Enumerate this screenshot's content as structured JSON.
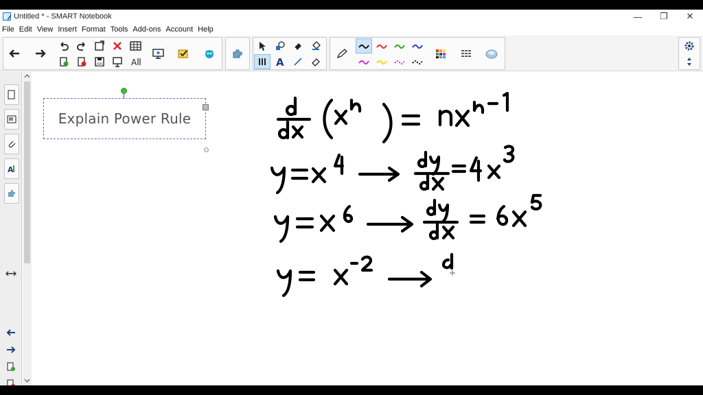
{
  "window": {
    "title": "Untitled * - SMART Notebook",
    "minimize": "—",
    "restore": "❐",
    "close": "✕"
  },
  "menu": [
    "File",
    "Edit",
    "View",
    "Insert",
    "Format",
    "Tools",
    "Add-ons",
    "Account",
    "Help"
  ],
  "canvas": {
    "textbox": "Explain Power Rule"
  },
  "colors": {
    "pen_red": "#e0302a",
    "pen_green": "#2fa32f",
    "pen_blue": "#2a3ccf",
    "pen_magenta": "#d22bd2",
    "pen_yellow": "#f2e22b",
    "accent": "#1a73c7"
  },
  "icons": [
    "back-icon",
    "forward-icon",
    "undo-icon",
    "redo-icon",
    "page-icon",
    "delete-icon",
    "table-icon",
    "screen-share-icon",
    "response-icon",
    "lab-icon",
    "addons-icon",
    "select-icon",
    "shapes-icon",
    "eraser-icon",
    "fill-icon",
    "text-icon",
    "line-icon",
    "pen-icon",
    "color-palette-icon",
    "line-style-icon",
    "fill-effects-icon",
    "settings-icon",
    "move-toolbar-icon"
  ]
}
